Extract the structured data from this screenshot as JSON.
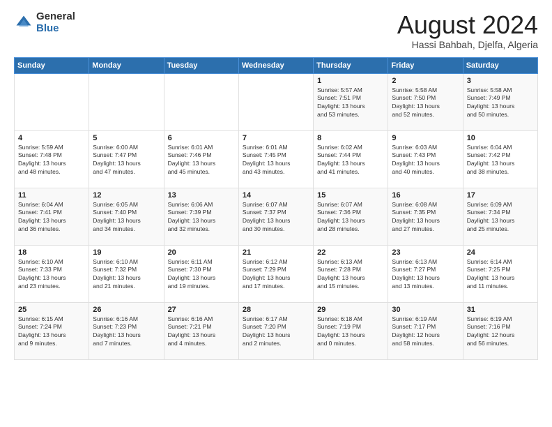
{
  "logo": {
    "general": "General",
    "blue": "Blue"
  },
  "header": {
    "month": "August 2024",
    "location": "Hassi Bahbah, Djelfa, Algeria"
  },
  "weekdays": [
    "Sunday",
    "Monday",
    "Tuesday",
    "Wednesday",
    "Thursday",
    "Friday",
    "Saturday"
  ],
  "weeks": [
    [
      {
        "day": "",
        "info": ""
      },
      {
        "day": "",
        "info": ""
      },
      {
        "day": "",
        "info": ""
      },
      {
        "day": "",
        "info": ""
      },
      {
        "day": "1",
        "info": "Sunrise: 5:57 AM\nSunset: 7:51 PM\nDaylight: 13 hours\nand 53 minutes."
      },
      {
        "day": "2",
        "info": "Sunrise: 5:58 AM\nSunset: 7:50 PM\nDaylight: 13 hours\nand 52 minutes."
      },
      {
        "day": "3",
        "info": "Sunrise: 5:58 AM\nSunset: 7:49 PM\nDaylight: 13 hours\nand 50 minutes."
      }
    ],
    [
      {
        "day": "4",
        "info": "Sunrise: 5:59 AM\nSunset: 7:48 PM\nDaylight: 13 hours\nand 48 minutes."
      },
      {
        "day": "5",
        "info": "Sunrise: 6:00 AM\nSunset: 7:47 PM\nDaylight: 13 hours\nand 47 minutes."
      },
      {
        "day": "6",
        "info": "Sunrise: 6:01 AM\nSunset: 7:46 PM\nDaylight: 13 hours\nand 45 minutes."
      },
      {
        "day": "7",
        "info": "Sunrise: 6:01 AM\nSunset: 7:45 PM\nDaylight: 13 hours\nand 43 minutes."
      },
      {
        "day": "8",
        "info": "Sunrise: 6:02 AM\nSunset: 7:44 PM\nDaylight: 13 hours\nand 41 minutes."
      },
      {
        "day": "9",
        "info": "Sunrise: 6:03 AM\nSunset: 7:43 PM\nDaylight: 13 hours\nand 40 minutes."
      },
      {
        "day": "10",
        "info": "Sunrise: 6:04 AM\nSunset: 7:42 PM\nDaylight: 13 hours\nand 38 minutes."
      }
    ],
    [
      {
        "day": "11",
        "info": "Sunrise: 6:04 AM\nSunset: 7:41 PM\nDaylight: 13 hours\nand 36 minutes."
      },
      {
        "day": "12",
        "info": "Sunrise: 6:05 AM\nSunset: 7:40 PM\nDaylight: 13 hours\nand 34 minutes."
      },
      {
        "day": "13",
        "info": "Sunrise: 6:06 AM\nSunset: 7:39 PM\nDaylight: 13 hours\nand 32 minutes."
      },
      {
        "day": "14",
        "info": "Sunrise: 6:07 AM\nSunset: 7:37 PM\nDaylight: 13 hours\nand 30 minutes."
      },
      {
        "day": "15",
        "info": "Sunrise: 6:07 AM\nSunset: 7:36 PM\nDaylight: 13 hours\nand 28 minutes."
      },
      {
        "day": "16",
        "info": "Sunrise: 6:08 AM\nSunset: 7:35 PM\nDaylight: 13 hours\nand 27 minutes."
      },
      {
        "day": "17",
        "info": "Sunrise: 6:09 AM\nSunset: 7:34 PM\nDaylight: 13 hours\nand 25 minutes."
      }
    ],
    [
      {
        "day": "18",
        "info": "Sunrise: 6:10 AM\nSunset: 7:33 PM\nDaylight: 13 hours\nand 23 minutes."
      },
      {
        "day": "19",
        "info": "Sunrise: 6:10 AM\nSunset: 7:32 PM\nDaylight: 13 hours\nand 21 minutes."
      },
      {
        "day": "20",
        "info": "Sunrise: 6:11 AM\nSunset: 7:30 PM\nDaylight: 13 hours\nand 19 minutes."
      },
      {
        "day": "21",
        "info": "Sunrise: 6:12 AM\nSunset: 7:29 PM\nDaylight: 13 hours\nand 17 minutes."
      },
      {
        "day": "22",
        "info": "Sunrise: 6:13 AM\nSunset: 7:28 PM\nDaylight: 13 hours\nand 15 minutes."
      },
      {
        "day": "23",
        "info": "Sunrise: 6:13 AM\nSunset: 7:27 PM\nDaylight: 13 hours\nand 13 minutes."
      },
      {
        "day": "24",
        "info": "Sunrise: 6:14 AM\nSunset: 7:25 PM\nDaylight: 13 hours\nand 11 minutes."
      }
    ],
    [
      {
        "day": "25",
        "info": "Sunrise: 6:15 AM\nSunset: 7:24 PM\nDaylight: 13 hours\nand 9 minutes."
      },
      {
        "day": "26",
        "info": "Sunrise: 6:16 AM\nSunset: 7:23 PM\nDaylight: 13 hours\nand 7 minutes."
      },
      {
        "day": "27",
        "info": "Sunrise: 6:16 AM\nSunset: 7:21 PM\nDaylight: 13 hours\nand 4 minutes."
      },
      {
        "day": "28",
        "info": "Sunrise: 6:17 AM\nSunset: 7:20 PM\nDaylight: 13 hours\nand 2 minutes."
      },
      {
        "day": "29",
        "info": "Sunrise: 6:18 AM\nSunset: 7:19 PM\nDaylight: 13 hours\nand 0 minutes."
      },
      {
        "day": "30",
        "info": "Sunrise: 6:19 AM\nSunset: 7:17 PM\nDaylight: 12 hours\nand 58 minutes."
      },
      {
        "day": "31",
        "info": "Sunrise: 6:19 AM\nSunset: 7:16 PM\nDaylight: 12 hours\nand 56 minutes."
      }
    ]
  ]
}
